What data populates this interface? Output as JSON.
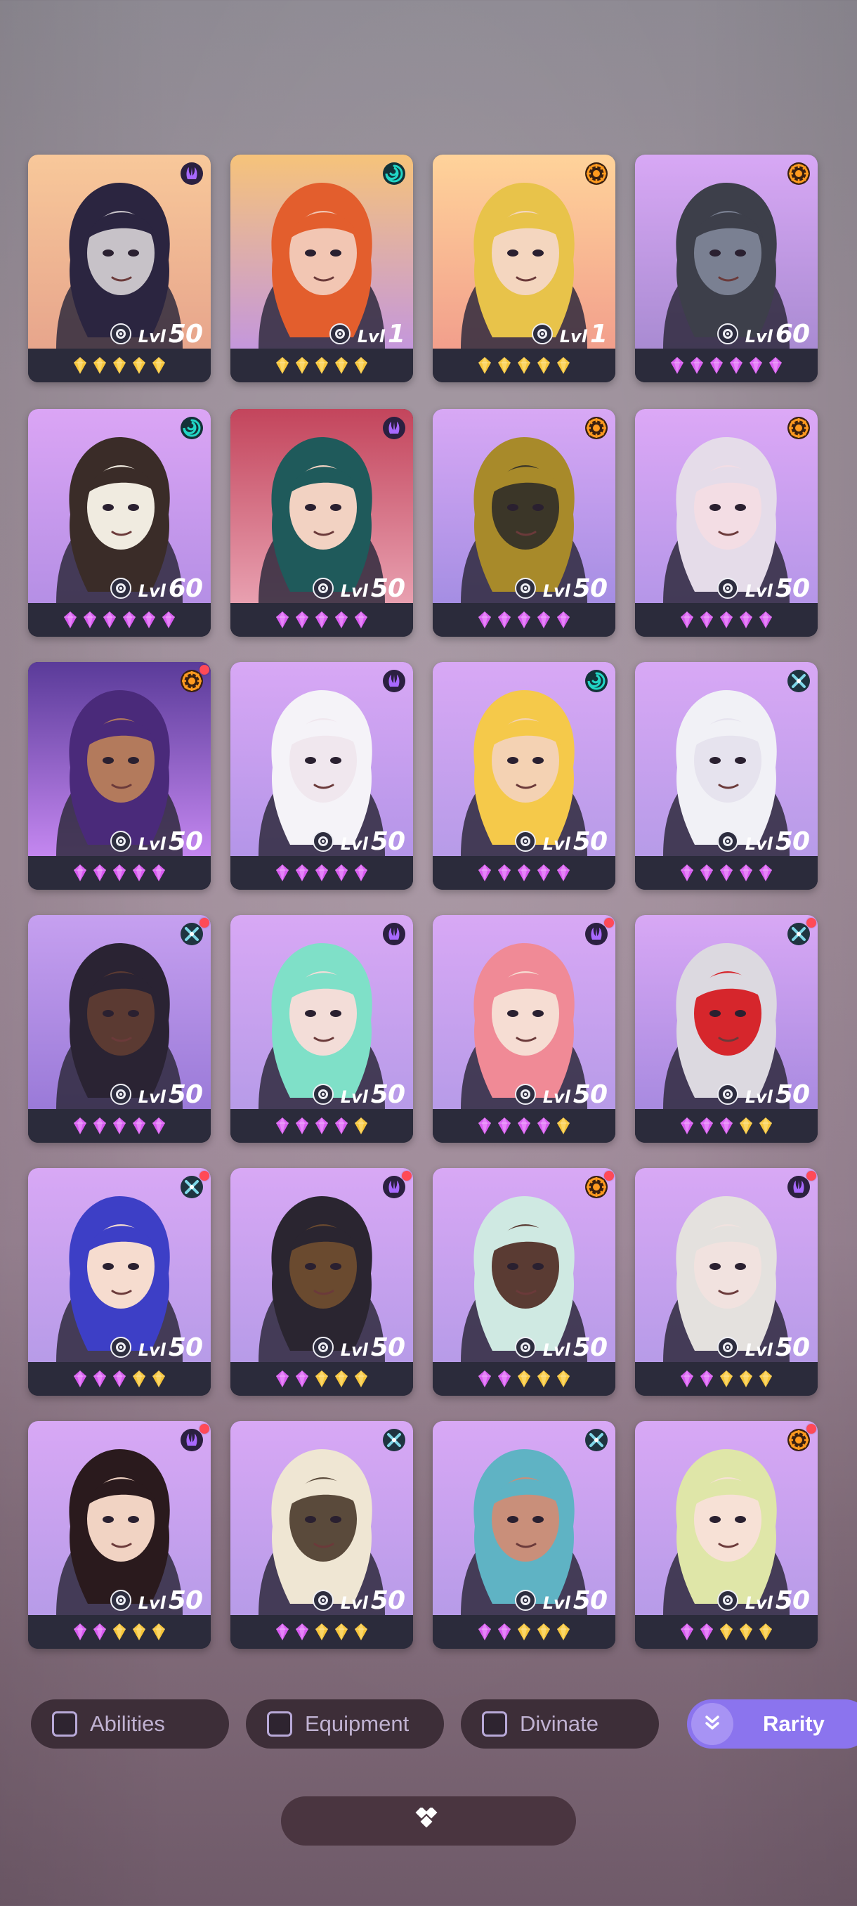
{
  "colors": {
    "gold_gem": "#f6c53a",
    "purple_gem": "#d85bf0",
    "mystic": "#a869ff",
    "wind": "#22d6c6",
    "fire": "#ff9a1f",
    "frost": "#7fd7e8",
    "notification": "#ff4a57",
    "rarity_button": "#8b74ee"
  },
  "heroes": [
    {
      "level_label": "Lvl",
      "level": "50",
      "class_icon": "mystic",
      "notify": false,
      "gems": [
        "gold",
        "gold",
        "gold",
        "gold",
        "gold"
      ],
      "bg": [
        "#f8c89a",
        "#e7a58c"
      ],
      "skin": "#c7c2c8",
      "hair": "#2b2540"
    },
    {
      "level_label": "Lvl",
      "level": "1",
      "class_icon": "wind",
      "notify": false,
      "gems": [
        "gold",
        "gold",
        "gold",
        "gold",
        "gold"
      ],
      "bg": [
        "#f6c37a",
        "#c497dc"
      ],
      "skin": "#f2c6b3",
      "hair": "#e35e2d"
    },
    {
      "level_label": "Lvl",
      "level": "1",
      "class_icon": "fire",
      "notify": false,
      "gems": [
        "gold",
        "gold",
        "gold",
        "gold",
        "gold"
      ],
      "bg": [
        "#ffd39a",
        "#f29f8c"
      ],
      "skin": "#f4d6bf",
      "hair": "#e8c34a"
    },
    {
      "level_label": "Lvl",
      "level": "60",
      "class_icon": "fire",
      "notify": false,
      "gems": [
        "purple",
        "purple",
        "purple",
        "purple",
        "purple",
        "purple"
      ],
      "bg": [
        "#d8a8f5",
        "#a98bd2"
      ],
      "skin": "#7a8092",
      "hair": "#3d3f4a"
    },
    {
      "level_label": "Lvl",
      "level": "60",
      "class_icon": "wind",
      "notify": false,
      "gems": [
        "purple",
        "purple",
        "purple",
        "purple",
        "purple",
        "purple"
      ],
      "bg": [
        "#dba5f5",
        "#b58fe5"
      ],
      "skin": "#f0ebe0",
      "hair": "#3a2c28"
    },
    {
      "level_label": "Lvl",
      "level": "50",
      "class_icon": "mystic",
      "notify": false,
      "gems": [
        "purple",
        "purple",
        "purple",
        "purple",
        "purple"
      ],
      "bg": [
        "#c3455c",
        "#e8a0b0"
      ],
      "skin": "#f2d2c2",
      "hair": "#1f5a5b"
    },
    {
      "level_label": "Lvl",
      "level": "50",
      "class_icon": "fire",
      "notify": false,
      "gems": [
        "purple",
        "purple",
        "purple",
        "purple",
        "purple"
      ],
      "bg": [
        "#d8a8f5",
        "#a58ee3"
      ],
      "skin": "#3b3628",
      "hair": "#a88a2a"
    },
    {
      "level_label": "Lvl",
      "level": "50",
      "class_icon": "fire",
      "notify": false,
      "gems": [
        "purple",
        "purple",
        "purple",
        "purple",
        "purple"
      ],
      "bg": [
        "#dca8f6",
        "#b596e8"
      ],
      "skin": "#f3dde4",
      "hair": "#e5dce9"
    },
    {
      "level_label": "Lvl",
      "level": "50",
      "class_icon": "fire",
      "notify": true,
      "gems": [
        "purple",
        "purple",
        "purple",
        "purple",
        "purple"
      ],
      "bg": [
        "#5a3b99",
        "#c487f0"
      ],
      "skin": "#b37a5c",
      "hair": "#4a2a7a"
    },
    {
      "level_label": "Lvl",
      "level": "50",
      "class_icon": "mystic",
      "notify": false,
      "gems": [
        "purple",
        "purple",
        "purple",
        "purple",
        "purple"
      ],
      "bg": [
        "#d8a8f5",
        "#b495e8"
      ],
      "skin": "#f0e7ee",
      "hair": "#f5f3f8"
    },
    {
      "level_label": "Lvl",
      "level": "50",
      "class_icon": "wind",
      "notify": false,
      "gems": [
        "purple",
        "purple",
        "purple",
        "purple",
        "purple"
      ],
      "bg": [
        "#d8a8f5",
        "#b79be8"
      ],
      "skin": "#f4d2b3",
      "hair": "#f5c94a"
    },
    {
      "level_label": "Lvl",
      "level": "50",
      "class_icon": "frost",
      "notify": false,
      "gems": [
        "purple",
        "purple",
        "purple",
        "purple",
        "purple"
      ],
      "bg": [
        "#d8a8f5",
        "#b79be8"
      ],
      "skin": "#e6e3ee",
      "hair": "#f1f1f6"
    },
    {
      "level_label": "Lvl",
      "level": "50",
      "class_icon": "frost",
      "notify": true,
      "gems": [
        "purple",
        "purple",
        "purple",
        "purple",
        "purple"
      ],
      "bg": [
        "#c6a0f0",
        "#9a7ad8"
      ],
      "skin": "#5b3a32",
      "hair": "#2a2333"
    },
    {
      "level_label": "Lvl",
      "level": "50",
      "class_icon": "mystic",
      "notify": false,
      "gems": [
        "purple",
        "purple",
        "purple",
        "purple",
        "gold"
      ],
      "bg": [
        "#d8a8f5",
        "#b79be8"
      ],
      "skin": "#f3ddd8",
      "hair": "#7fe0c8"
    },
    {
      "level_label": "Lvl",
      "level": "50",
      "class_icon": "mystic",
      "notify": true,
      "gems": [
        "purple",
        "purple",
        "purple",
        "purple",
        "gold"
      ],
      "bg": [
        "#d8a8f5",
        "#b79be8"
      ],
      "skin": "#f6ddd3",
      "hair": "#f08a96"
    },
    {
      "level_label": "Lvl",
      "level": "50",
      "class_icon": "frost",
      "notify": true,
      "gems": [
        "purple",
        "purple",
        "purple",
        "gold",
        "gold"
      ],
      "bg": [
        "#d8a8f5",
        "#a88ae0"
      ],
      "skin": "#d6262c",
      "hair": "#dcd9e0"
    },
    {
      "level_label": "Lvl",
      "level": "50",
      "class_icon": "frost",
      "notify": true,
      "gems": [
        "purple",
        "purple",
        "purple",
        "gold",
        "gold"
      ],
      "bg": [
        "#d8a8f5",
        "#b79be8"
      ],
      "skin": "#f6dccf",
      "hair": "#3d3fc6"
    },
    {
      "level_label": "Lvl",
      "level": "50",
      "class_icon": "mystic",
      "notify": true,
      "gems": [
        "purple",
        "purple",
        "gold",
        "gold",
        "gold"
      ],
      "bg": [
        "#d8a8f5",
        "#b79be8"
      ],
      "skin": "#6a4a2f",
      "hair": "#2a2530"
    },
    {
      "level_label": "Lvl",
      "level": "50",
      "class_icon": "fire",
      "notify": true,
      "gems": [
        "purple",
        "purple",
        "gold",
        "gold",
        "gold"
      ],
      "bg": [
        "#d8a8f5",
        "#b79be8"
      ],
      "skin": "#5a3b33",
      "hair": "#cfe9e2"
    },
    {
      "level_label": "Lvl",
      "level": "50",
      "class_icon": "mystic",
      "notify": true,
      "gems": [
        "purple",
        "purple",
        "gold",
        "gold",
        "gold"
      ],
      "bg": [
        "#d8a8f5",
        "#b79be8"
      ],
      "skin": "#f1e2df",
      "hair": "#e4e1de"
    },
    {
      "level_label": "Lvl",
      "level": "50",
      "class_icon": "mystic",
      "notify": true,
      "gems": [
        "purple",
        "purple",
        "gold",
        "gold",
        "gold"
      ],
      "bg": [
        "#d8a8f5",
        "#b79be8"
      ],
      "skin": "#f1d3c3",
      "hair": "#2a1a1d"
    },
    {
      "level_label": "Lvl",
      "level": "50",
      "class_icon": "frost",
      "notify": false,
      "gems": [
        "purple",
        "purple",
        "gold",
        "gold",
        "gold"
      ],
      "bg": [
        "#d8a8f5",
        "#b79be8"
      ],
      "skin": "#5a4a3b",
      "hair": "#efe6d3"
    },
    {
      "level_label": "Lvl",
      "level": "50",
      "class_icon": "frost",
      "notify": false,
      "gems": [
        "purple",
        "purple",
        "gold",
        "gold",
        "gold"
      ],
      "bg": [
        "#d8a8f5",
        "#b79be8"
      ],
      "skin": "#c98f7a",
      "hair": "#5fb3c4"
    },
    {
      "level_label": "Lvl",
      "level": "50",
      "class_icon": "fire",
      "notify": true,
      "gems": [
        "purple",
        "purple",
        "gold",
        "gold",
        "gold"
      ],
      "bg": [
        "#d8a8f5",
        "#b79be8"
      ],
      "skin": "#f7e1d6",
      "hair": "#dfe6a8"
    }
  ],
  "filters": {
    "abilities": "Abilities",
    "equipment": "Equipment",
    "divinate": "Divinate",
    "rarity": "Rarity"
  },
  "expand_button_icon": "chevron-double-down-icon"
}
